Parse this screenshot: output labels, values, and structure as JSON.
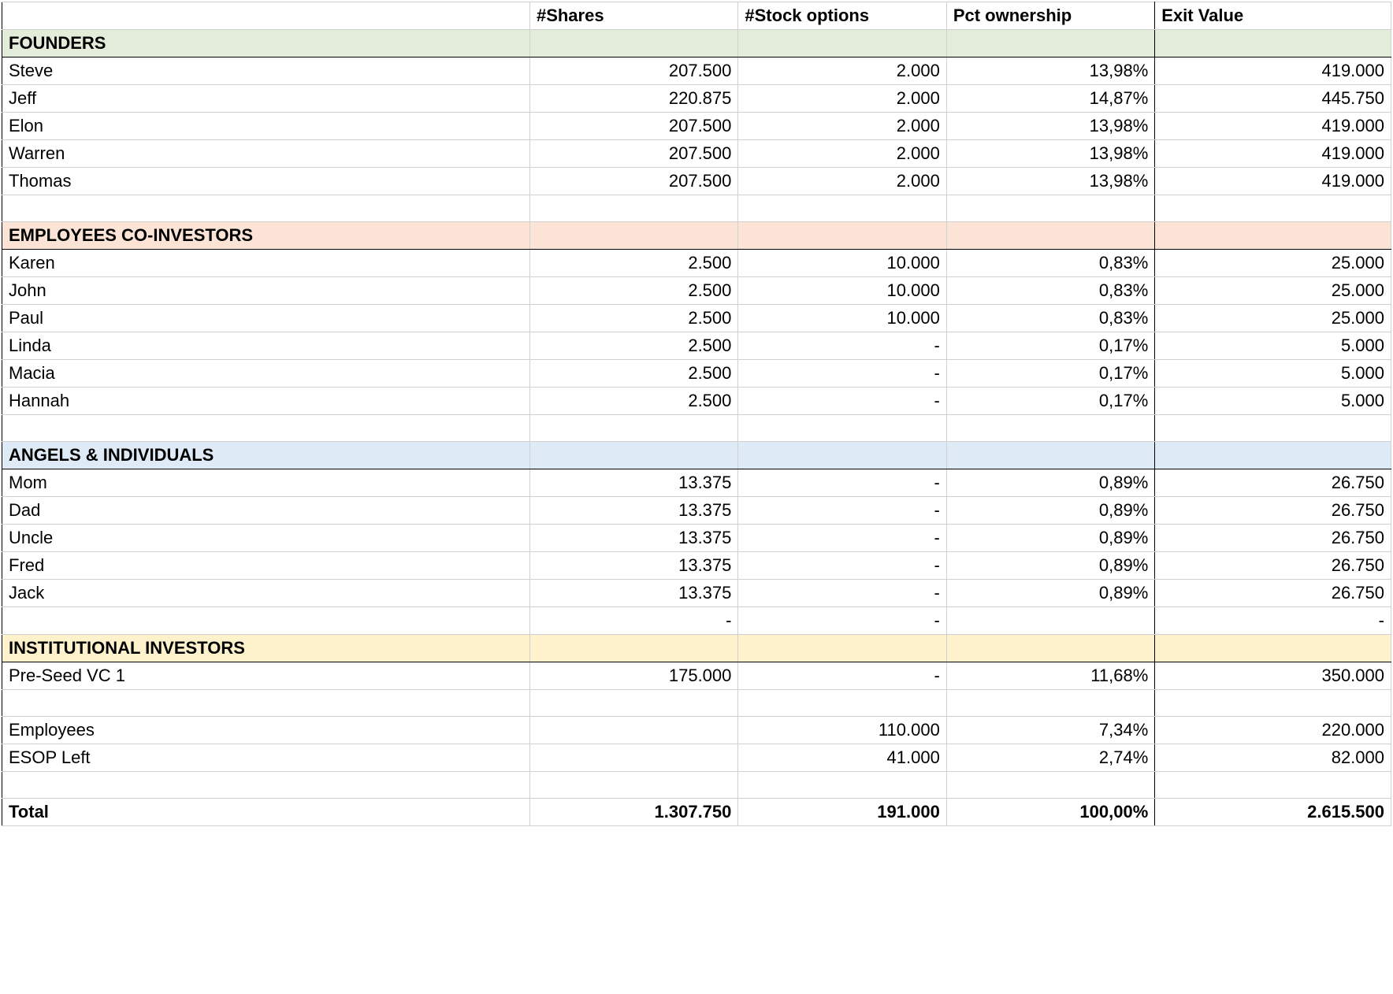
{
  "headers": {
    "name": "",
    "shares": "#Shares",
    "options": "#Stock options",
    "pct": "Pct ownership",
    "exit": "Exit Value"
  },
  "sections": {
    "founders": "FOUNDERS",
    "employees": "EMPLOYEES CO-INVESTORS",
    "angels": "ANGELS & INDIVIDUALS",
    "institutional": "INSTITUTIONAL INVESTORS"
  },
  "founders": [
    {
      "name": "Steve",
      "shares": "207.500",
      "options": "2.000",
      "pct": "13,98%",
      "exit": "419.000"
    },
    {
      "name": "Jeff",
      "shares": "220.875",
      "options": "2.000",
      "pct": "14,87%",
      "exit": "445.750"
    },
    {
      "name": "Elon",
      "shares": "207.500",
      "options": "2.000",
      "pct": "13,98%",
      "exit": "419.000"
    },
    {
      "name": "Warren",
      "shares": "207.500",
      "options": "2.000",
      "pct": "13,98%",
      "exit": "419.000"
    },
    {
      "name": "Thomas",
      "shares": "207.500",
      "options": "2.000",
      "pct": "13,98%",
      "exit": "419.000"
    }
  ],
  "employees": [
    {
      "name": "Karen",
      "shares": "2.500",
      "options": "10.000",
      "pct": "0,83%",
      "exit": "25.000"
    },
    {
      "name": "John",
      "shares": "2.500",
      "options": "10.000",
      "pct": "0,83%",
      "exit": "25.000"
    },
    {
      "name": "Paul",
      "shares": "2.500",
      "options": "10.000",
      "pct": "0,83%",
      "exit": "25.000"
    },
    {
      "name": "Linda",
      "shares": "2.500",
      "options": "-",
      "pct": "0,17%",
      "exit": "5.000"
    },
    {
      "name": "Macia",
      "shares": "2.500",
      "options": "-",
      "pct": "0,17%",
      "exit": "5.000"
    },
    {
      "name": "Hannah",
      "shares": "2.500",
      "options": "-",
      "pct": "0,17%",
      "exit": "5.000"
    }
  ],
  "angels": [
    {
      "name": "Mom",
      "shares": "13.375",
      "options": "-",
      "pct": "0,89%",
      "exit": "26.750"
    },
    {
      "name": "Dad",
      "shares": "13.375",
      "options": "-",
      "pct": "0,89%",
      "exit": "26.750"
    },
    {
      "name": "Uncle",
      "shares": "13.375",
      "options": "-",
      "pct": "0,89%",
      "exit": "26.750"
    },
    {
      "name": "Fred",
      "shares": "13.375",
      "options": "-",
      "pct": "0,89%",
      "exit": "26.750"
    },
    {
      "name": "Jack",
      "shares": "13.375",
      "options": "-",
      "pct": "0,89%",
      "exit": "26.750"
    }
  ],
  "angels_blank": {
    "name": "",
    "shares": "-",
    "options": "-",
    "pct": "",
    "exit": "-"
  },
  "institutional": [
    {
      "name": "Pre-Seed VC 1",
      "shares": "175.000",
      "options": "-",
      "pct": "11,68%",
      "exit": "350.000"
    }
  ],
  "inst_blank1": {
    "name": "",
    "shares": "",
    "options": "",
    "pct": "",
    "exit": ""
  },
  "other": [
    {
      "name": "Employees",
      "shares": "",
      "options": "110.000",
      "pct": "7,34%",
      "exit": "220.000"
    },
    {
      "name": "ESOP Left",
      "shares": "",
      "options": "41.000",
      "pct": "2,74%",
      "exit": "82.000"
    }
  ],
  "total": {
    "name": "Total",
    "shares": "1.307.750",
    "options": "191.000",
    "pct": "100,00%",
    "exit": "2.615.500"
  }
}
